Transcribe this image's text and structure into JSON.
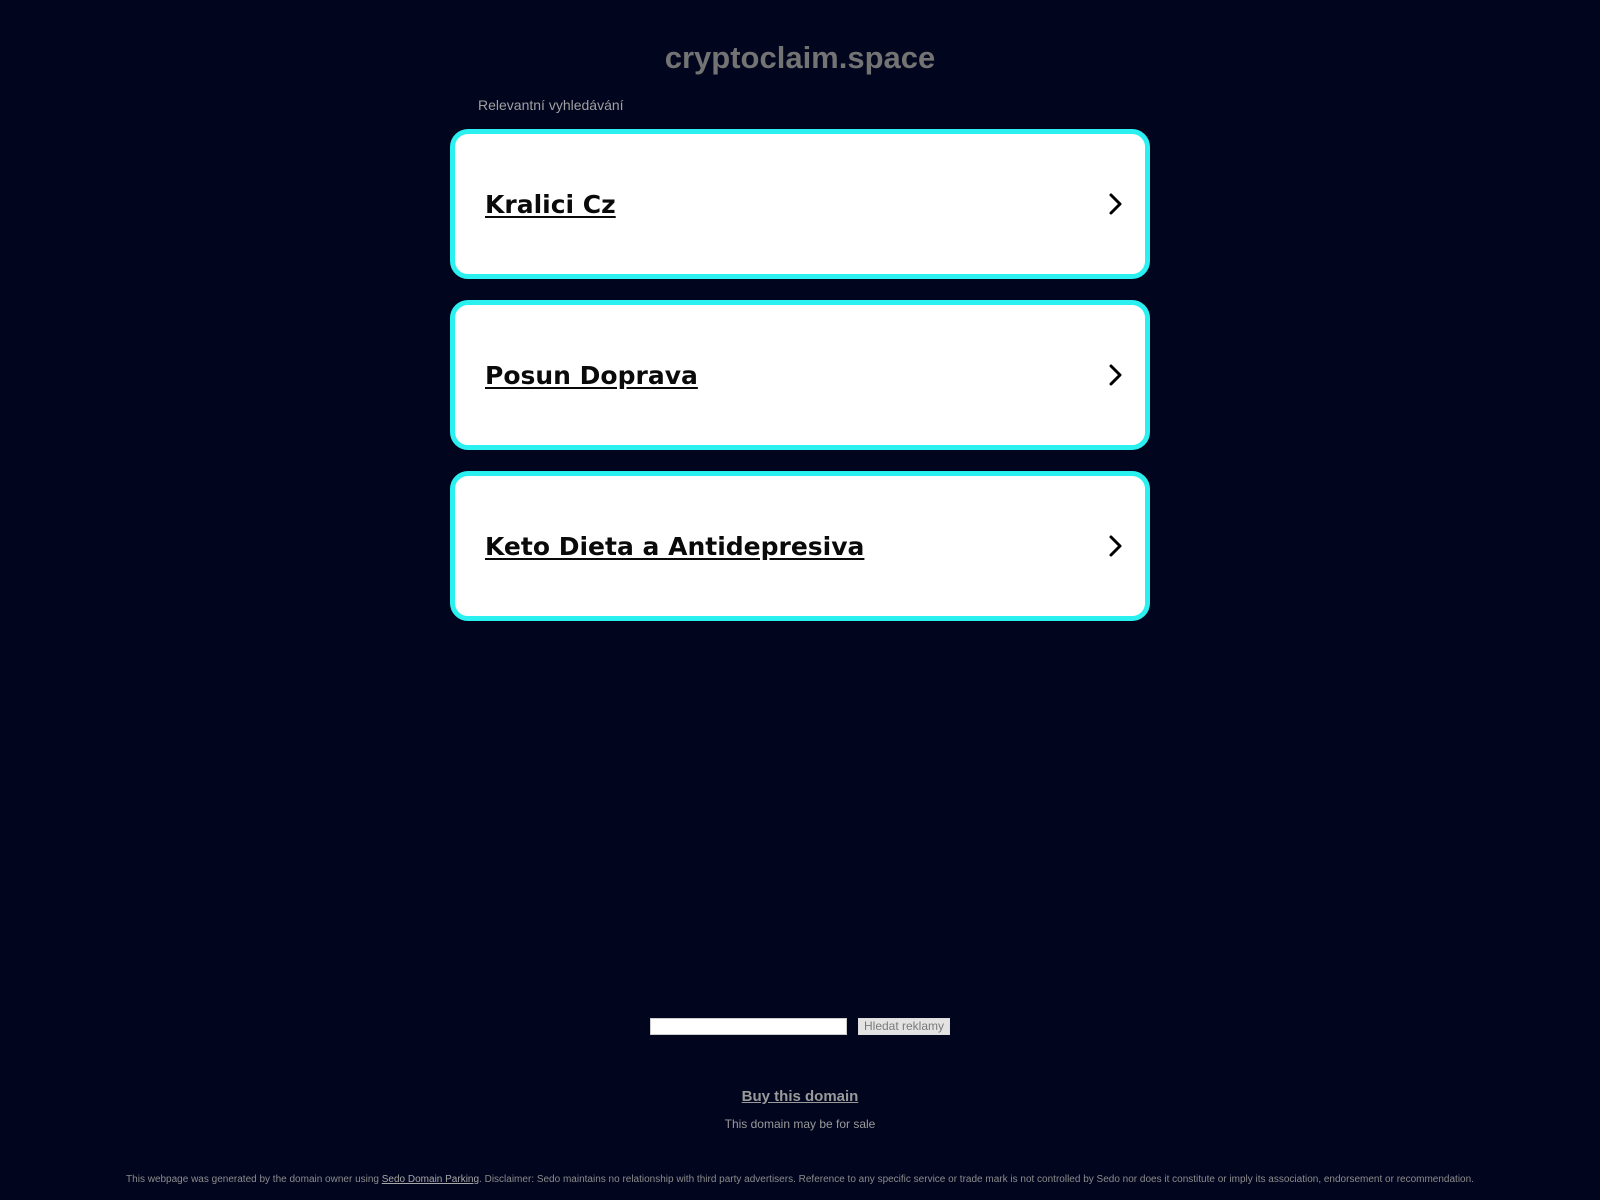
{
  "header": {
    "domain_title": "cryptoclaim.space",
    "related_label": "Relevantní vyhledávání"
  },
  "ads": [
    {
      "label": "Kralici Cz",
      "icon": "chevron-right-icon"
    },
    {
      "label": "Posun Doprava",
      "icon": "chevron-right-icon"
    },
    {
      "label": "Keto Dieta a Antidepresiva",
      "icon": "chevron-right-icon"
    }
  ],
  "search": {
    "value": "",
    "button_label": "Hledat reklamy"
  },
  "buy": {
    "link_label": "Buy this domain",
    "subtext": "This domain may be for sale"
  },
  "footer": {
    "prefix": "This webpage was generated by the domain owner using ",
    "link_label": "Sedo Domain Parking",
    "suffix": ". Disclaimer: Sedo maintains no relationship with third party advertisers. Reference to any specific service or trade mark is not controlled by Sedo nor does it constitute or imply its association, endorsement or recommendation."
  },
  "colors": {
    "background": "#01051e",
    "card_border": "#2bf0f0",
    "card_background": "#ffffff"
  }
}
